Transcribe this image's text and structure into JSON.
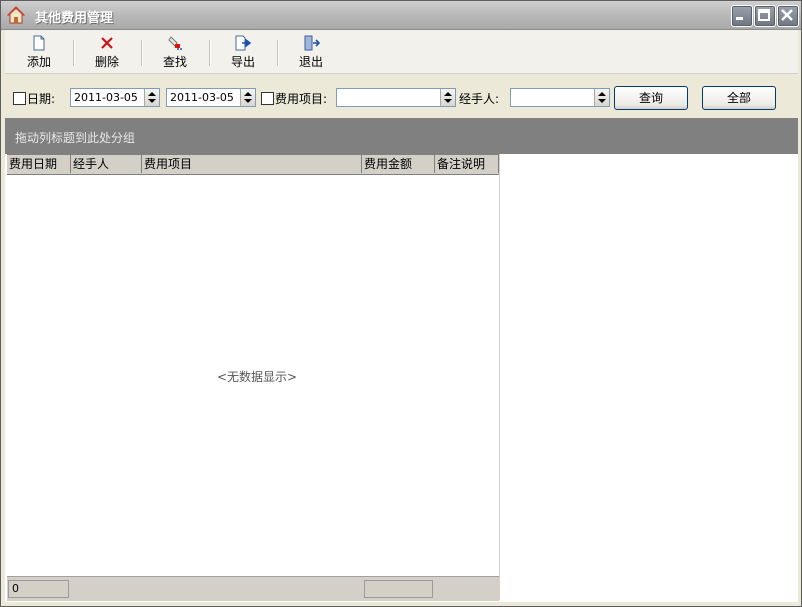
{
  "window": {
    "title": "其他费用管理"
  },
  "toolbar": {
    "items": [
      {
        "label": "添加",
        "icon": "new-document-icon"
      },
      {
        "label": "删除",
        "icon": "delete-x-icon"
      },
      {
        "label": "查找",
        "icon": "find-icon"
      },
      {
        "label": "导出",
        "icon": "export-icon"
      },
      {
        "label": "退出",
        "icon": "exit-door-icon"
      }
    ]
  },
  "filter": {
    "date_label": "日期:",
    "date_from": "2011-03-05",
    "date_to": "2011-03-05",
    "item_label": "费用项目:",
    "item_value": "",
    "handler_label": "经手人:",
    "handler_value": "",
    "query_button": "查询",
    "all_button": "全部"
  },
  "grid": {
    "group_hint": "拖动列标题到此处分组",
    "columns": [
      "费用日期",
      "经手人",
      "费用项目",
      "费用金额",
      "备注说明"
    ],
    "rows": [],
    "empty_text": "<无数据显示>",
    "footer_count": "0",
    "footer_sum": ""
  },
  "colors": {
    "title_bar": "#b9b9b9",
    "group_bar": "#808080",
    "header_bg": "#d4d0c8"
  }
}
